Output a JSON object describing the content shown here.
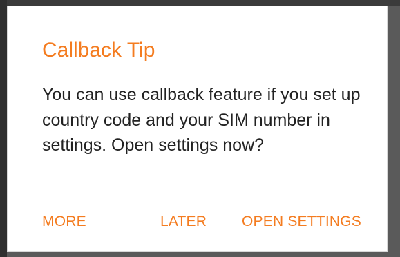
{
  "dialog": {
    "title": "Callback Tip",
    "message": "You can use callback feature if you set up country code and your SIM number in settings. Open settings now?",
    "buttons": {
      "more": "MORE",
      "later": "LATER",
      "open_settings": "OPEN SETTINGS"
    }
  },
  "colors": {
    "accent": "#f47c20",
    "text": "#222222",
    "dialog_background": "#ffffff"
  }
}
